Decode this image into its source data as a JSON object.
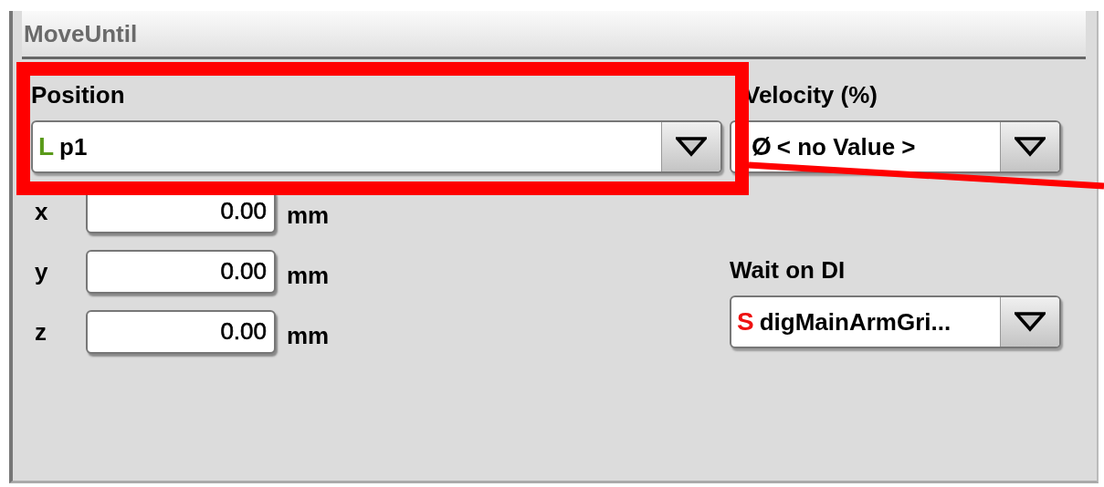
{
  "panel": {
    "title": "MoveUntil"
  },
  "position": {
    "label": "Position",
    "value": {
      "prefix": "L",
      "color": "#5a9a1a",
      "text": "p1"
    }
  },
  "coordinates": [
    {
      "label": "x",
      "value": "0.00",
      "unit": "mm"
    },
    {
      "label": "y",
      "value": "0.00",
      "unit": "mm"
    },
    {
      "label": "z",
      "value": "0.00",
      "unit": "mm"
    }
  ],
  "velocity": {
    "label": "Velocity (%)",
    "value": {
      "prefix": "Ø",
      "color": "#000000",
      "text": "< no Value >"
    }
  },
  "wait_on_di": {
    "label": "Wait on DI",
    "value": {
      "prefix": "S",
      "color": "#ee1111",
      "text": "digMainArmGri..."
    }
  }
}
